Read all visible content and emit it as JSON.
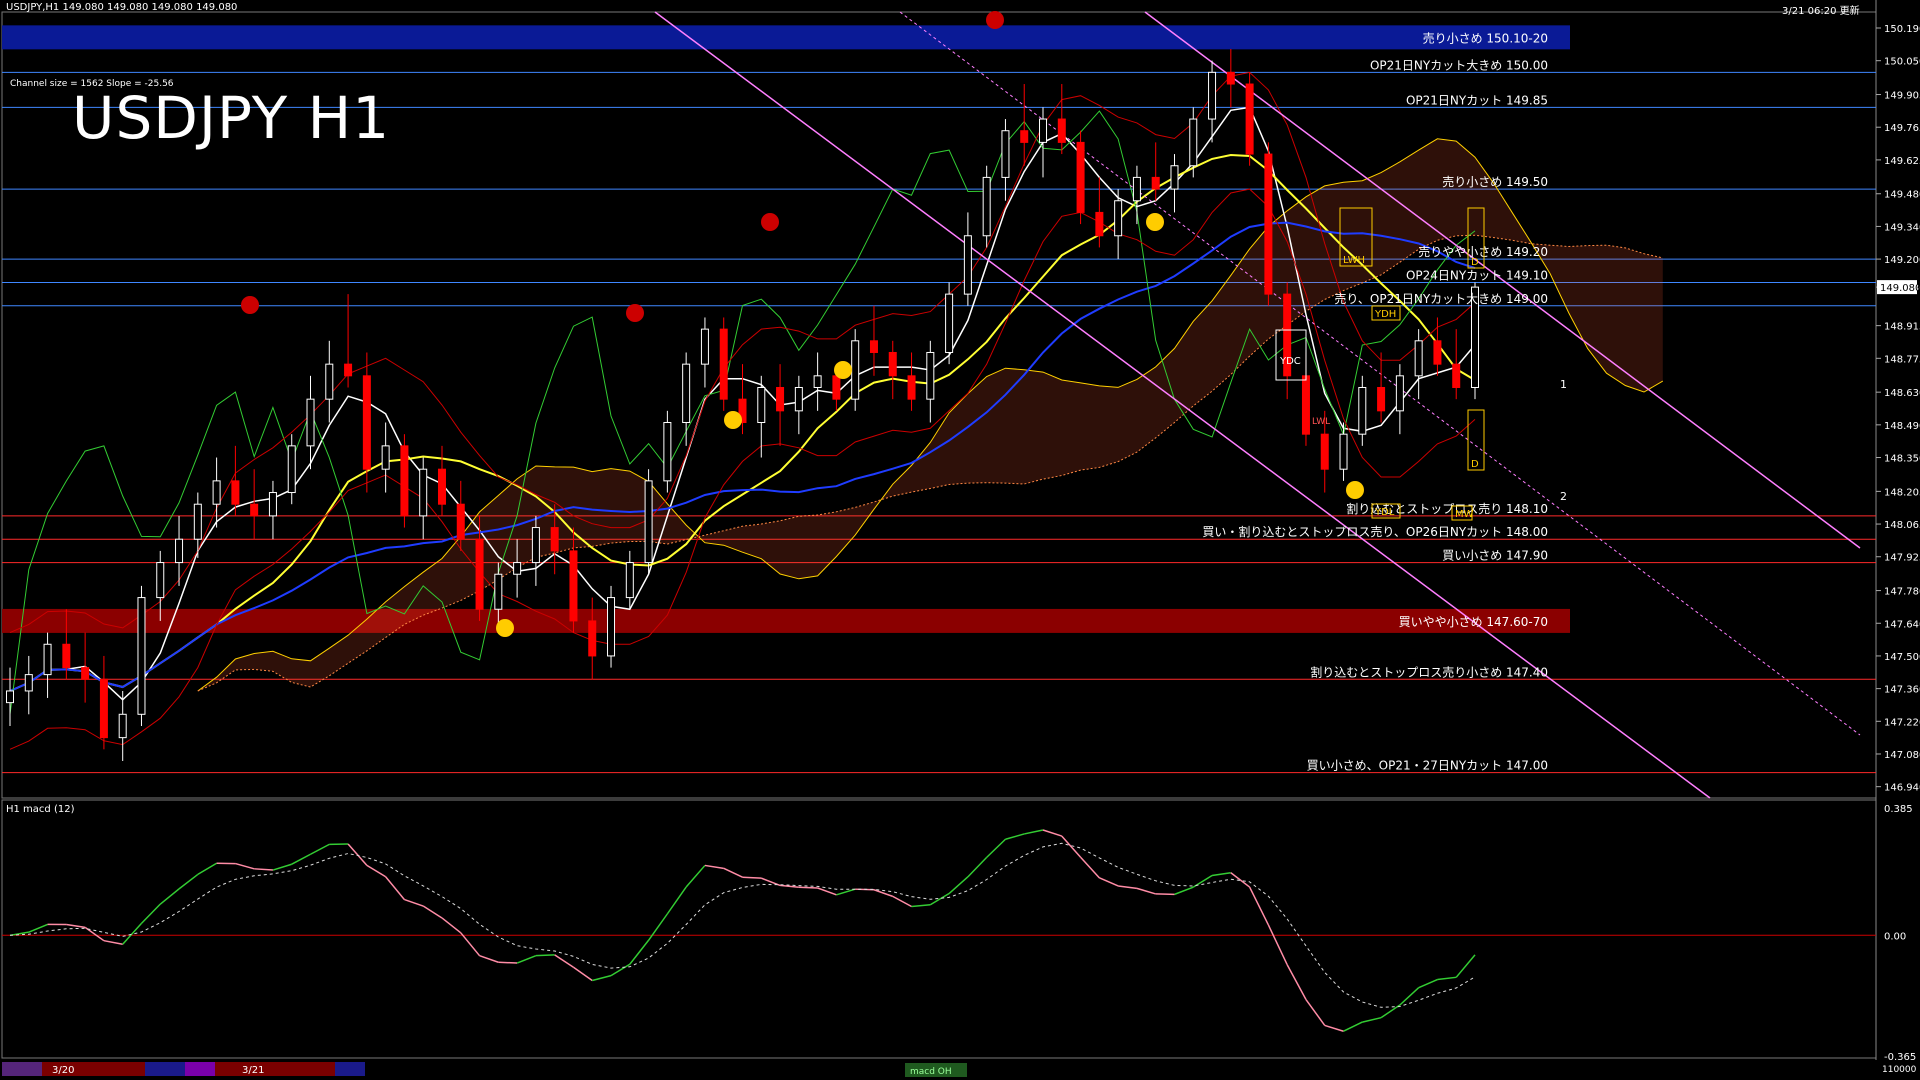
{
  "header": {
    "symbol_info": "USDJPY,H1  149.080 149.080 149.080 149.080",
    "datetime": "3/21 06:20 更新",
    "channel_info": "Channel size = 1562 Slope = -25.56",
    "title": "USDJPY H1"
  },
  "colors": {
    "background": "#000000",
    "bull_candle": "#ffffff",
    "bear_candle": "#ff0000",
    "sell_band": "#0a1a96",
    "buy_band": "#8b0000",
    "blue_line": "#3f87ff",
    "red_line": "#ff2a2a",
    "yellow_ma": "#ffff33",
    "blue_ma": "#1f3cff",
    "channel": "#ff7fff",
    "kumo_red": "#ff6a3c",
    "kumo_blue": "#2d63ff",
    "macd": "#33cc33",
    "macd_neg": "#ff8ca6"
  },
  "price_axis": {
    "ticks": [
      "150.190",
      "150.050",
      "149.905",
      "149.765",
      "149.625",
      "149.480",
      "149.340",
      "149.200",
      "149.080",
      "148.915",
      "148.775",
      "148.630",
      "148.490",
      "148.350",
      "148.205",
      "148.065",
      "147.925",
      "147.780",
      "147.640",
      "147.500",
      "147.360",
      "147.220",
      "147.080",
      "146.940"
    ],
    "current_price": "149.080"
  },
  "levels": [
    {
      "label": "売り小さめ 150.10-20",
      "price": 150.15,
      "kind": "band-sell"
    },
    {
      "label": "OP21日NYカット大きめ 150.00",
      "price": 150.0,
      "kind": "blue"
    },
    {
      "label": "OP21日NYカット 149.85",
      "price": 149.85,
      "kind": "blue"
    },
    {
      "label": "売り小さめ 149.50",
      "price": 149.5,
      "kind": "blue"
    },
    {
      "label": "売りやや小さめ 149.20",
      "price": 149.2,
      "kind": "blue"
    },
    {
      "label": "OP24日NYカット 149.10",
      "price": 149.1,
      "kind": "blue"
    },
    {
      "label": "売り、OP21日NYカット大きめ 149.00",
      "price": 149.0,
      "kind": "blue"
    },
    {
      "label": "割り込むとストップロス売り 148.10",
      "price": 148.1,
      "kind": "red"
    },
    {
      "label": "買い・割り込むとストップロス売り、OP26日NYカット 148.00",
      "price": 148.0,
      "kind": "red"
    },
    {
      "label": "買い小さめ 147.90",
      "price": 147.9,
      "kind": "red"
    },
    {
      "label": "買いやや小さめ 147.60-70",
      "price": 147.65,
      "kind": "band-buy"
    },
    {
      "label": "割り込むとストップロス売り小さめ 147.40",
      "price": 147.4,
      "kind": "red"
    },
    {
      "label": "買い小さめ、OP21・27日NYカット 147.00",
      "price": 147.0,
      "kind": "red"
    }
  ],
  "annotations": {
    "ydh": "YDH",
    "ydl": "YDL",
    "ydc": "YDC",
    "lwh": "LWH",
    "lwl": "LWL",
    "mw": "MW",
    "d": "D",
    "one": "1",
    "two": "2"
  },
  "macd_panel": {
    "title": "H1  macd (12)",
    "ticks": [
      "0.385",
      "0.00",
      "-0.365"
    ],
    "bottom_tick": "110000"
  },
  "bottom_bar": {
    "dates": [
      "3/20",
      "3/21"
    ],
    "tab": "macd OH"
  },
  "chart_data": {
    "type": "candlestick",
    "title": "USDJPY H1",
    "ylim": [
      146.9,
      150.25
    ],
    "x_labels": [
      "3/20",
      "3/21"
    ],
    "candles": [
      [
        147.3,
        147.45,
        147.2,
        147.35
      ],
      [
        147.35,
        147.5,
        147.25,
        147.42
      ],
      [
        147.42,
        147.6,
        147.32,
        147.55
      ],
      [
        147.55,
        147.7,
        147.4,
        147.45
      ],
      [
        147.45,
        147.6,
        147.3,
        147.4
      ],
      [
        147.4,
        147.5,
        147.1,
        147.15
      ],
      [
        147.15,
        147.35,
        147.05,
        147.25
      ],
      [
        147.25,
        147.8,
        147.2,
        147.75
      ],
      [
        147.75,
        147.95,
        147.65,
        147.9
      ],
      [
        147.9,
        148.1,
        147.8,
        148.0
      ],
      [
        148.0,
        148.2,
        147.92,
        148.15
      ],
      [
        148.15,
        148.35,
        148.05,
        148.25
      ],
      [
        148.25,
        148.4,
        148.1,
        148.15
      ],
      [
        148.15,
        148.3,
        148.0,
        148.1
      ],
      [
        148.1,
        148.25,
        148.0,
        148.2
      ],
      [
        148.2,
        148.45,
        148.15,
        148.4
      ],
      [
        148.4,
        148.7,
        148.3,
        148.6
      ],
      [
        148.6,
        148.85,
        148.5,
        148.75
      ],
      [
        148.75,
        149.05,
        148.65,
        148.7
      ],
      [
        148.7,
        148.8,
        148.2,
        148.3
      ],
      [
        148.3,
        148.5,
        148.2,
        148.4
      ],
      [
        148.4,
        148.45,
        148.05,
        148.1
      ],
      [
        148.1,
        148.35,
        148.0,
        148.3
      ],
      [
        148.3,
        148.4,
        148.1,
        148.15
      ],
      [
        148.15,
        148.25,
        147.95,
        148.0
      ],
      [
        148.0,
        148.1,
        147.65,
        147.7
      ],
      [
        147.7,
        147.9,
        147.62,
        147.85
      ],
      [
        147.85,
        148.0,
        147.75,
        147.9
      ],
      [
        147.9,
        148.1,
        147.8,
        148.05
      ],
      [
        148.05,
        148.15,
        147.85,
        147.95
      ],
      [
        147.95,
        148.05,
        147.6,
        147.65
      ],
      [
        147.65,
        147.75,
        147.4,
        147.5
      ],
      [
        147.5,
        147.8,
        147.45,
        147.75
      ],
      [
        147.75,
        147.95,
        147.7,
        147.9
      ],
      [
        147.9,
        148.3,
        147.85,
        148.25
      ],
      [
        148.25,
        148.55,
        148.2,
        148.5
      ],
      [
        148.5,
        148.8,
        148.4,
        148.75
      ],
      [
        148.75,
        148.95,
        148.65,
        148.9
      ],
      [
        148.9,
        148.95,
        148.55,
        148.6
      ],
      [
        148.6,
        148.75,
        148.45,
        148.5
      ],
      [
        148.5,
        148.7,
        148.35,
        148.65
      ],
      [
        148.65,
        148.75,
        148.4,
        148.55
      ],
      [
        148.55,
        148.7,
        148.45,
        148.65
      ],
      [
        148.65,
        148.8,
        148.55,
        148.7
      ],
      [
        148.7,
        148.75,
        148.55,
        148.6
      ],
      [
        148.6,
        148.9,
        148.55,
        148.85
      ],
      [
        148.85,
        149.0,
        148.7,
        148.8
      ],
      [
        148.8,
        148.85,
        148.6,
        148.7
      ],
      [
        148.7,
        148.8,
        148.55,
        148.6
      ],
      [
        148.6,
        148.85,
        148.5,
        148.8
      ],
      [
        148.8,
        149.1,
        148.75,
        149.05
      ],
      [
        149.05,
        149.4,
        149.0,
        149.3
      ],
      [
        149.3,
        149.6,
        149.25,
        149.55
      ],
      [
        149.55,
        149.8,
        149.45,
        149.75
      ],
      [
        149.75,
        149.95,
        149.6,
        149.7
      ],
      [
        149.7,
        149.85,
        149.55,
        149.8
      ],
      [
        149.8,
        149.95,
        149.65,
        149.7
      ],
      [
        149.7,
        149.75,
        149.35,
        149.4
      ],
      [
        149.4,
        149.55,
        149.25,
        149.3
      ],
      [
        149.3,
        149.5,
        149.2,
        149.45
      ],
      [
        149.45,
        149.6,
        149.35,
        149.55
      ],
      [
        149.55,
        149.7,
        149.45,
        149.5
      ],
      [
        149.5,
        149.65,
        149.4,
        149.6
      ],
      [
        149.6,
        149.85,
        149.55,
        149.8
      ],
      [
        149.8,
        150.05,
        149.7,
        150.0
      ],
      [
        150.0,
        150.1,
        149.85,
        149.95
      ],
      [
        149.95,
        150.0,
        149.6,
        149.65
      ],
      [
        149.65,
        149.7,
        149.0,
        149.05
      ],
      [
        149.05,
        149.1,
        148.6,
        148.7
      ],
      [
        148.7,
        148.8,
        148.4,
        148.45
      ],
      [
        148.45,
        148.55,
        148.2,
        148.3
      ],
      [
        148.3,
        148.5,
        148.25,
        148.45
      ],
      [
        148.45,
        148.7,
        148.4,
        148.65
      ],
      [
        148.65,
        148.8,
        148.5,
        148.55
      ],
      [
        148.55,
        148.75,
        148.45,
        148.7
      ],
      [
        148.7,
        148.9,
        148.6,
        148.85
      ],
      [
        148.85,
        148.95,
        148.7,
        148.75
      ],
      [
        148.75,
        148.9,
        148.6,
        148.65
      ],
      [
        148.65,
        149.1,
        148.6,
        149.08
      ]
    ]
  }
}
